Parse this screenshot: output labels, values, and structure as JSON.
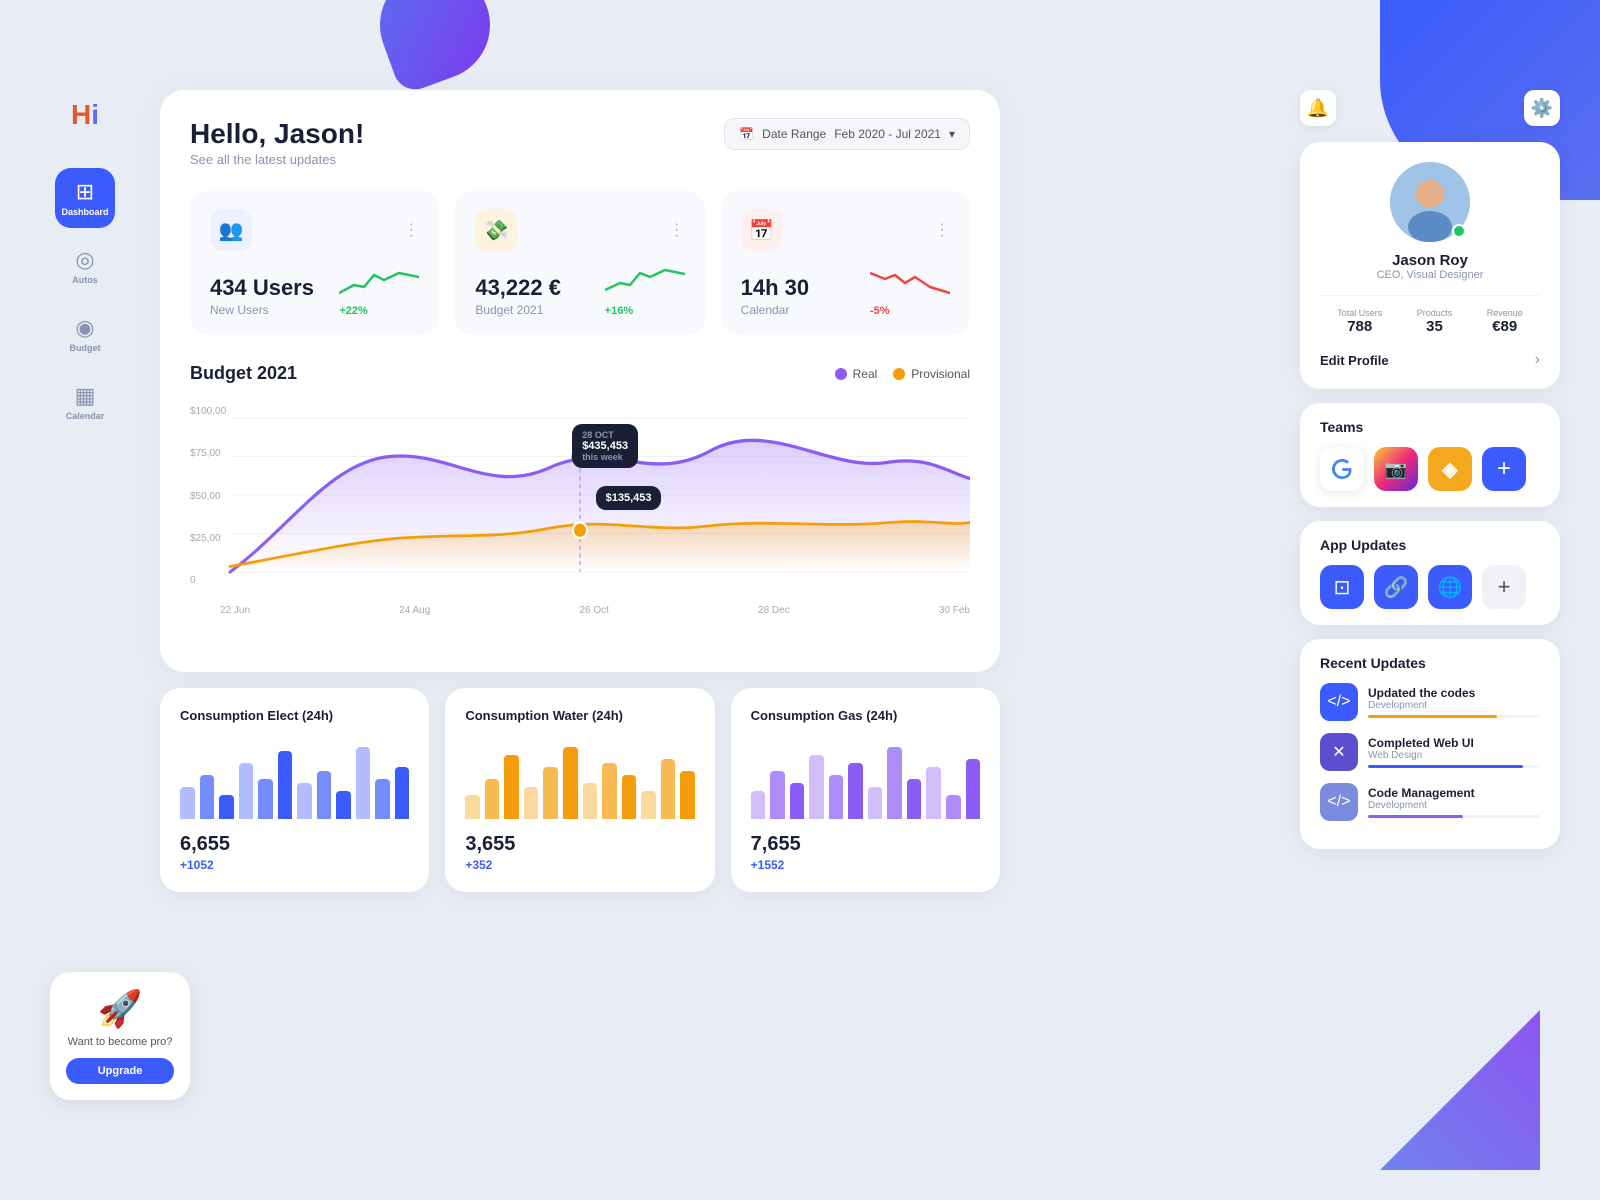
{
  "app": {
    "logo": "H",
    "blob_top": true,
    "blob_right": true
  },
  "sidebar": {
    "nav_items": [
      {
        "id": "dashboard",
        "icon": "⊞",
        "label": "Dashboard",
        "active": true
      },
      {
        "id": "autos",
        "icon": "◎",
        "label": "Autos",
        "active": false
      },
      {
        "id": "budget",
        "icon": "💰",
        "label": "Budget",
        "active": false
      },
      {
        "id": "calendar",
        "icon": "📅",
        "label": "Calendar",
        "active": false
      }
    ],
    "upgrade": {
      "text": "Want to become pro?",
      "button_label": "Upgrade"
    }
  },
  "header": {
    "greeting": "Hello, Jason!",
    "subtitle": "See all the latest updates",
    "date_range_label": "Date Range",
    "date_range_value": "Feb 2020 - Jul 2021"
  },
  "stat_cards": [
    {
      "id": "users",
      "icon": "👥",
      "icon_color": "blue",
      "value": "434 Users",
      "label": "New Users",
      "trend": "+22%",
      "trend_dir": "up",
      "trend_color": "green"
    },
    {
      "id": "budget",
      "icon": "💸",
      "icon_color": "orange",
      "value": "43,222 €",
      "label": "Budget 2021",
      "trend": "+16%",
      "trend_dir": "up",
      "trend_color": "green"
    },
    {
      "id": "calendar",
      "icon": "📅",
      "icon_color": "red",
      "value": "14h 30",
      "label": "Calendar",
      "trend": "-5%",
      "trend_dir": "down",
      "trend_color": "red"
    }
  ],
  "budget_chart": {
    "title": "Budget 2021",
    "legend": [
      {
        "label": "Real",
        "color": "#8b5cf6"
      },
      {
        "label": "Provisional",
        "color": "#f59e0b"
      }
    ],
    "tooltip1": {
      "date": "28 OCT",
      "value": "$435,453",
      "sub": "this week"
    },
    "tooltip2": {
      "value": "$135,453"
    },
    "x_labels": [
      "22 Jun",
      "24 Aug",
      "26 Oct",
      "28 Dec",
      "30 Feb"
    ],
    "y_labels": [
      "$100,00",
      "$75,00",
      "$50,00",
      "$25,00",
      "0"
    ]
  },
  "consumption_cards": [
    {
      "id": "elect",
      "title": "Consumption Elect (24h)",
      "value": "6,655",
      "change": "+1052",
      "bar_color": "#3b5bfc",
      "bars": [
        40,
        55,
        30,
        70,
        50,
        85,
        45,
        60,
        35,
        90,
        50,
        65
      ]
    },
    {
      "id": "water",
      "title": "Consumption Water (24h)",
      "value": "3,655",
      "change": "+352",
      "bar_color": "#f59e0b",
      "bars": [
        30,
        50,
        80,
        40,
        65,
        90,
        45,
        70,
        55,
        35,
        75,
        60
      ]
    },
    {
      "id": "gas",
      "title": "Consumption Gas (24h)",
      "value": "7,655",
      "change": "+1552",
      "bar_color": "#8b5cf6",
      "bars": [
        35,
        60,
        45,
        80,
        55,
        70,
        40,
        90,
        50,
        65,
        30,
        75
      ]
    }
  ],
  "profile": {
    "name": "Jason Roy",
    "role": "CEO, Visual Designer",
    "avatar_emoji": "🧑",
    "stats": [
      {
        "label": "Total Users",
        "value": "788"
      },
      {
        "label": "Products",
        "value": "35"
      },
      {
        "label": "Revenue",
        "value": "€89"
      }
    ],
    "edit_label": "Edit Profile"
  },
  "teams": {
    "title": "Teams",
    "items": [
      {
        "id": "google",
        "icon": "G",
        "color": "google"
      },
      {
        "id": "instagram",
        "icon": "📷",
        "color": "instagram"
      },
      {
        "id": "binance",
        "icon": "◈",
        "color": "binance"
      },
      {
        "id": "add",
        "icon": "+",
        "color": "add"
      }
    ]
  },
  "app_updates": {
    "title": "App Updates",
    "items": [
      {
        "id": "qr",
        "icon": "⊡",
        "color": "qr"
      },
      {
        "id": "link",
        "icon": "🔗",
        "color": "link"
      },
      {
        "id": "globe",
        "icon": "🌐",
        "color": "globe"
      },
      {
        "id": "more",
        "icon": "+",
        "color": "more"
      }
    ]
  },
  "recent_updates": {
    "title": "Recent Updates",
    "items": [
      {
        "id": "code",
        "icon": "</>",
        "icon_class": "code",
        "title": "Updated the codes",
        "category": "Development",
        "progress": 75,
        "progress_color": "#f59e0b"
      },
      {
        "id": "design",
        "icon": "✕",
        "icon_class": "design",
        "title": "Completed Web UI",
        "category": "Web Design",
        "progress": 90,
        "progress_color": "#3b5bfc"
      },
      {
        "id": "management",
        "icon": "</>",
        "icon_class": "management",
        "title": "Code Management",
        "category": "Development",
        "progress": 55,
        "progress_color": "#8b5cf6"
      }
    ]
  }
}
